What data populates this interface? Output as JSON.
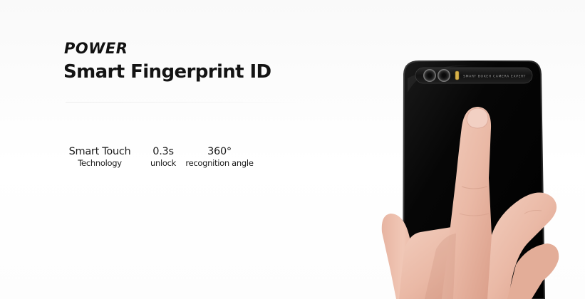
{
  "brand": {
    "name": "POWER"
  },
  "headline": "Smart Fingerprint ID",
  "features": [
    {
      "value": "Smart Touch",
      "label": "Technology"
    },
    {
      "value": "0.3s",
      "label": "unlock"
    },
    {
      "value": "360°",
      "label": "recognition angle"
    }
  ],
  "phone": {
    "camera_strip_text": "SMART BOKEH CAMERA EXPERT",
    "color": "#050505"
  }
}
